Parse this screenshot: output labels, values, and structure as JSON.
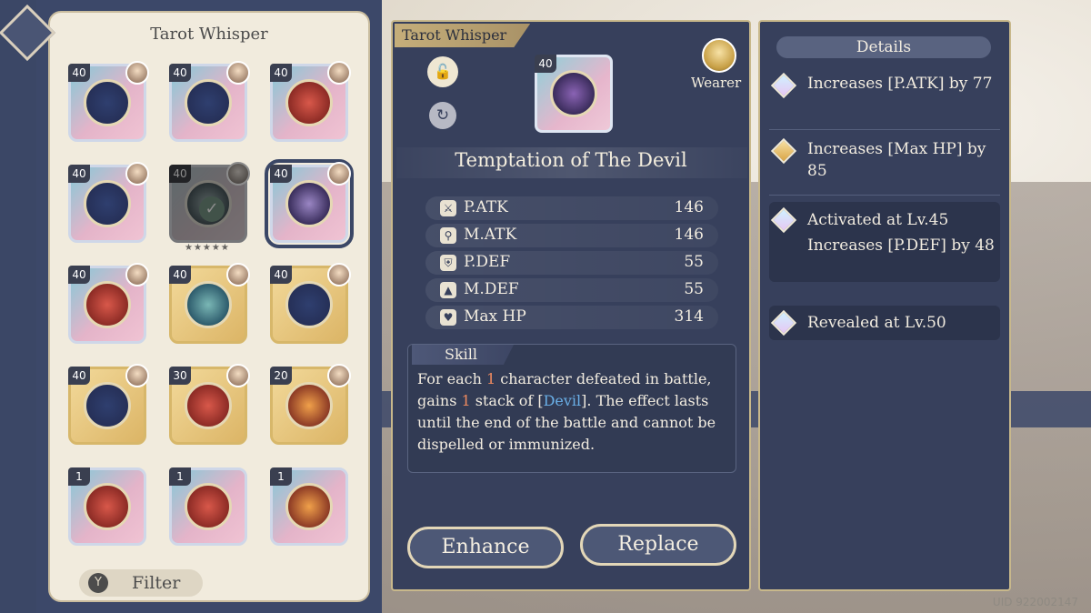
{
  "inventory": {
    "title": "Tarot Whisper",
    "filter_label": "Filter",
    "cards": [
      {
        "level": "40",
        "style": "pastel",
        "emblem": "navy",
        "state": "normal"
      },
      {
        "level": "40",
        "style": "pastel",
        "emblem": "navy",
        "state": "normal"
      },
      {
        "level": "40",
        "style": "pastel",
        "emblem": "red",
        "state": "normal"
      },
      {
        "level": "40",
        "style": "pastel",
        "emblem": "navy",
        "state": "normal"
      },
      {
        "level": "40",
        "style": "pastel",
        "emblem": "teal",
        "state": "equipped"
      },
      {
        "level": "40",
        "style": "pastel",
        "emblem": "purple",
        "state": "selected"
      },
      {
        "level": "40",
        "style": "pastel",
        "emblem": "red",
        "state": "normal"
      },
      {
        "level": "40",
        "style": "gold",
        "emblem": "teal",
        "state": "normal"
      },
      {
        "level": "40",
        "style": "gold",
        "emblem": "navy",
        "state": "normal"
      },
      {
        "level": "40",
        "style": "gold",
        "emblem": "navy",
        "state": "normal"
      },
      {
        "level": "30",
        "style": "gold",
        "emblem": "red",
        "state": "normal"
      },
      {
        "level": "20",
        "style": "gold",
        "emblem": "orange",
        "state": "normal"
      },
      {
        "level": "1",
        "style": "pastel",
        "emblem": "red",
        "state": "normal"
      },
      {
        "level": "1",
        "style": "pastel",
        "emblem": "red",
        "state": "normal"
      },
      {
        "level": "1",
        "style": "pastel",
        "emblem": "orange",
        "state": "normal"
      }
    ]
  },
  "item": {
    "tag": "Tarot Whisper",
    "level": "40",
    "name": "Temptation of The Devil",
    "wearer_label": "Wearer",
    "stats": [
      {
        "name": "P.ATK",
        "value": "146",
        "icon": "sword-icon"
      },
      {
        "name": "M.ATK",
        "value": "146",
        "icon": "staff-icon"
      },
      {
        "name": "P.DEF",
        "value": "55",
        "icon": "shield-icon"
      },
      {
        "name": "M.DEF",
        "value": "55",
        "icon": "hat-icon"
      },
      {
        "name": "Max HP",
        "value": "314",
        "icon": "heart-icon"
      }
    ],
    "skill_label": "Skill",
    "skill": {
      "p1": "For each ",
      "n1": "1",
      "p2": " character defeated in battle, gains ",
      "n2": "1",
      "p3": " stack of [",
      "kw": "Devil",
      "p4": "]. The effect lasts until the end of the battle and cannot be dispelled or immunized."
    },
    "enhance_label": "Enhance",
    "replace_label": "Replace"
  },
  "details": {
    "title": "Details",
    "entries": [
      {
        "text": "Increases [P.ATK] by 77",
        "gem": "blue"
      },
      {
        "text": "Increases [Max HP] by 85",
        "gem": "gold"
      },
      {
        "line1": "Activated at Lv.45",
        "text": "Increases [P.DEF] by 48",
        "gem": "blue"
      },
      {
        "text": "Revealed at Lv.50",
        "gem": "blue"
      }
    ]
  },
  "uid": "UID 922002147",
  "colors": {
    "panel": "#37405c",
    "accent_gold": "#c8b88b",
    "highlight_orange": "#ef8a5f",
    "highlight_blue": "#6ab0e8"
  }
}
